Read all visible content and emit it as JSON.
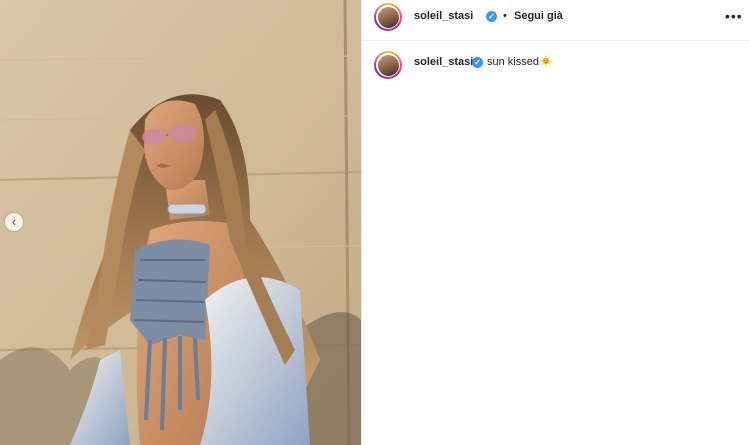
{
  "post": {
    "username": "soleil_stasi",
    "follow_label": "Segui già",
    "separator": "•",
    "more_label": "•••",
    "caption_text": "sun kissed",
    "caption_emoji": "sun-with-face-icon",
    "image_description": "",
    "carousel_prev": "‹"
  },
  "colors": {
    "verified_badge": "#3897f0",
    "text": "#262626",
    "story_ring": [
      "#f9ce34",
      "#ee2a7b",
      "#6228d7"
    ]
  }
}
